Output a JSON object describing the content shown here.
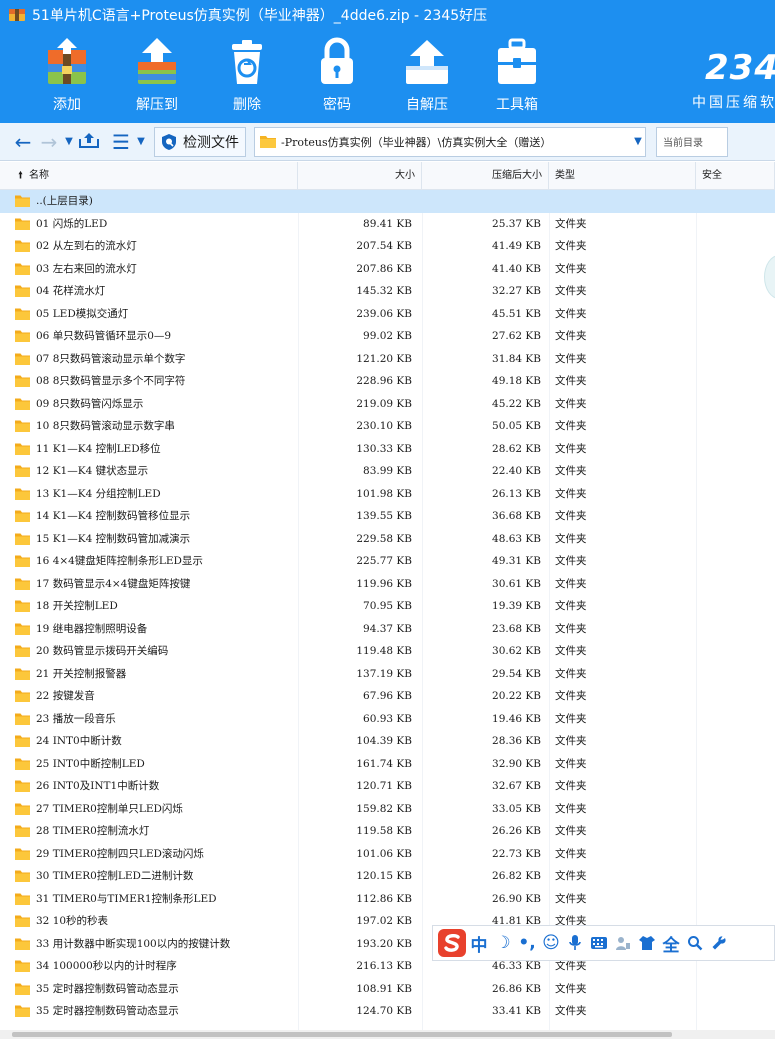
{
  "window": {
    "title": "51单片机C语言+Proteus仿真实例（毕业神器）_4dde6.zip - 2345好压"
  },
  "toolbar": {
    "items": [
      {
        "label": "添加",
        "icon": "add-icon"
      },
      {
        "label": "解压到",
        "icon": "extract-icon"
      },
      {
        "label": "删除",
        "icon": "delete-icon"
      },
      {
        "label": "密码",
        "icon": "lock-icon"
      },
      {
        "label": "自解压",
        "icon": "self-extract-icon"
      },
      {
        "label": "工具箱",
        "icon": "toolbox-icon"
      }
    ],
    "brand_number": "234",
    "brand_sub": "中国压缩软"
  },
  "addressbar": {
    "check_files_label": "检测文件",
    "path": "-Proteus仿真实例（毕业神器）\\仿真实例大全（赠送）",
    "search_placeholder": "当前目录"
  },
  "table": {
    "columns": {
      "name": "名称",
      "size": "大小",
      "packed": "压缩后大小",
      "type": "类型",
      "safety": "安全"
    },
    "rows": [
      {
        "name": "..(上层目录)",
        "size": "",
        "packed": "",
        "type": ""
      },
      {
        "name": "01 闪烁的LED",
        "size": "89.41 KB",
        "packed": "25.37 KB",
        "type": "文件夹"
      },
      {
        "name": "02 从左到右的流水灯",
        "size": "207.54 KB",
        "packed": "41.49 KB",
        "type": "文件夹"
      },
      {
        "name": "03 左右来回的流水灯",
        "size": "207.86 KB",
        "packed": "41.40 KB",
        "type": "文件夹"
      },
      {
        "name": "04 花样流水灯",
        "size": "145.32 KB",
        "packed": "32.27 KB",
        "type": "文件夹"
      },
      {
        "name": "05 LED模拟交通灯",
        "size": "239.06 KB",
        "packed": "45.51 KB",
        "type": "文件夹"
      },
      {
        "name": "06 单只数码管循环显示0—9",
        "size": "99.02 KB",
        "packed": "27.62 KB",
        "type": "文件夹"
      },
      {
        "name": "07 8只数码管滚动显示单个数字",
        "size": "121.20 KB",
        "packed": "31.84 KB",
        "type": "文件夹"
      },
      {
        "name": "08 8只数码管显示多个不同字符",
        "size": "228.96 KB",
        "packed": "49.18 KB",
        "type": "文件夹"
      },
      {
        "name": "09 8只数码管闪烁显示",
        "size": "219.09 KB",
        "packed": "45.22 KB",
        "type": "文件夹"
      },
      {
        "name": "10 8只数码管滚动显示数字串",
        "size": "230.10 KB",
        "packed": "50.05 KB",
        "type": "文件夹"
      },
      {
        "name": "11 K1—K4 控制LED移位",
        "size": "130.33 KB",
        "packed": "28.62 KB",
        "type": "文件夹"
      },
      {
        "name": "12 K1—K4 键状态显示",
        "size": "83.99 KB",
        "packed": "22.40 KB",
        "type": "文件夹"
      },
      {
        "name": "13 K1—K4 分组控制LED",
        "size": "101.98 KB",
        "packed": "26.13 KB",
        "type": "文件夹"
      },
      {
        "name": "14 K1—K4 控制数码管移位显示",
        "size": "139.55 KB",
        "packed": "36.68 KB",
        "type": "文件夹"
      },
      {
        "name": "15 K1—K4 控制数码管加减演示",
        "size": "229.58 KB",
        "packed": "48.63 KB",
        "type": "文件夹"
      },
      {
        "name": "16 4×4键盘矩阵控制条形LED显示",
        "size": "225.77 KB",
        "packed": "49.31 KB",
        "type": "文件夹"
      },
      {
        "name": "17 数码管显示4×4键盘矩阵按键",
        "size": "119.96 KB",
        "packed": "30.61 KB",
        "type": "文件夹"
      },
      {
        "name": "18 开关控制LED",
        "size": "70.95 KB",
        "packed": "19.39 KB",
        "type": "文件夹"
      },
      {
        "name": "19 继电器控制照明设备",
        "size": "94.37 KB",
        "packed": "23.68 KB",
        "type": "文件夹"
      },
      {
        "name": "20 数码管显示拨码开关编码",
        "size": "119.48 KB",
        "packed": "30.62 KB",
        "type": "文件夹"
      },
      {
        "name": "21 开关控制报警器",
        "size": "137.19 KB",
        "packed": "29.54 KB",
        "type": "文件夹"
      },
      {
        "name": "22 按键发音",
        "size": "67.96 KB",
        "packed": "20.22 KB",
        "type": "文件夹"
      },
      {
        "name": "23 播放一段音乐",
        "size": "60.93 KB",
        "packed": "19.46 KB",
        "type": "文件夹"
      },
      {
        "name": "24 INT0中断计数",
        "size": "104.39 KB",
        "packed": "28.36 KB",
        "type": "文件夹"
      },
      {
        "name": "25 INT0中断控制LED",
        "size": "161.74 KB",
        "packed": "32.90 KB",
        "type": "文件夹"
      },
      {
        "name": "26 INT0及INT1中断计数",
        "size": "120.71 KB",
        "packed": "32.67 KB",
        "type": "文件夹"
      },
      {
        "name": "27 TIMER0控制单只LED闪烁",
        "size": "159.82 KB",
        "packed": "33.05 KB",
        "type": "文件夹"
      },
      {
        "name": "28 TIMER0控制流水灯",
        "size": "119.58 KB",
        "packed": "26.26 KB",
        "type": "文件夹"
      },
      {
        "name": "29 TIMER0控制四只LED滚动闪烁",
        "size": "101.06 KB",
        "packed": "22.73 KB",
        "type": "文件夹"
      },
      {
        "name": "30 TIMER0控制LED二进制计数",
        "size": "120.15 KB",
        "packed": "26.82 KB",
        "type": "文件夹"
      },
      {
        "name": "31 TIMER0与TIMER1控制条形LED",
        "size": "112.86 KB",
        "packed": "26.90 KB",
        "type": "文件夹"
      },
      {
        "name": "32 10秒的秒表",
        "size": "197.02 KB",
        "packed": "41.81 KB",
        "type": "文件夹"
      },
      {
        "name": "33 用计数器中断实现100以内的按键计数",
        "size": "193.20 KB",
        "packed": "",
        "type": ""
      },
      {
        "name": "34 100000秒以内的计时程序",
        "size": "216.13 KB",
        "packed": "46.33 KB",
        "type": "文件夹"
      },
      {
        "name": "35 定时器控制数码管动态显示",
        "size": "108.91 KB",
        "packed": "26.86 KB",
        "type": "文件夹"
      },
      {
        "name": "35 定时器控制数码管动态显示",
        "size": "124.70 KB",
        "packed": "33.41 KB",
        "type": "文件夹"
      }
    ]
  },
  "ime": {
    "mode_label": "中",
    "full_label": "全"
  }
}
